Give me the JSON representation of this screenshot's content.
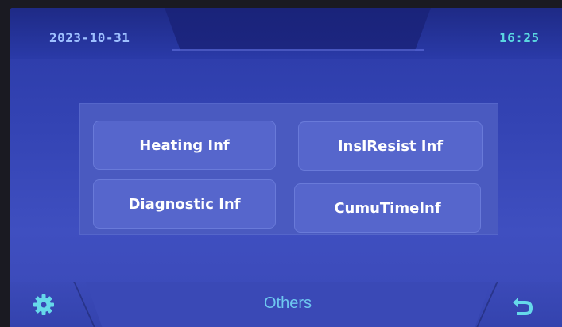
{
  "header": {
    "date": "2023-10-31",
    "time": "16:25"
  },
  "menu": {
    "items": [
      {
        "label": "Heating Inf"
      },
      {
        "label": "InslResist Inf"
      },
      {
        "label": "Diagnostic Inf"
      },
      {
        "label": "CumuTimeInf"
      }
    ]
  },
  "footer": {
    "title": "Others",
    "left_icon": "gear-icon",
    "right_icon": "back-arrow-icon"
  },
  "colors": {
    "background": "#3343b3",
    "tile": "#5666cc",
    "date_text": "#9ec0ff",
    "time_text": "#5ad6e0",
    "footer_title": "#6ec8f0",
    "icon": "#66d9ea"
  }
}
